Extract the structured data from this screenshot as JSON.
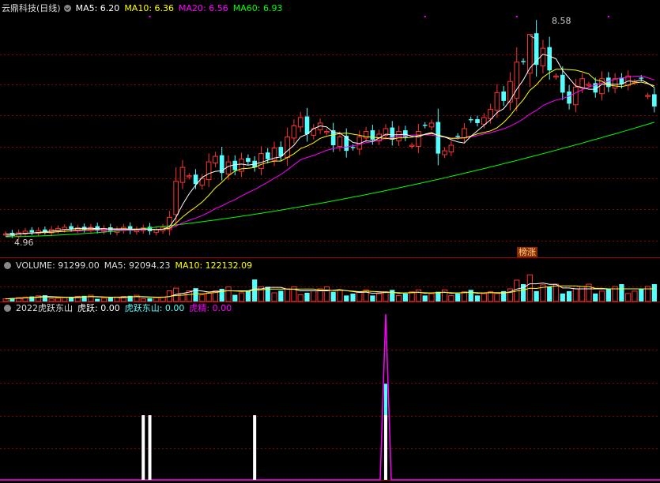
{
  "header_main": {
    "title": "云鼎科技(日线)",
    "ma5": "MA5: 6.20",
    "ma10": "MA10: 6.36",
    "ma20": "MA20: 6.56",
    "ma60": "MA60: 6.93"
  },
  "header_volume": {
    "title": "VOLUME: 91299.00",
    "ma5": "MA5: 92094.23",
    "ma10": "MA10: 122132.09"
  },
  "header_indicator": {
    "title": "2022虎跃东山",
    "huyue": "虎跃: 0.00",
    "huyuedongshan": "虎跃东山: 0.00",
    "hujing": "虎精: 0.00"
  },
  "annotations": {
    "high_price": "8.58",
    "low_price": "4.96",
    "badge": "榜涨"
  },
  "colors": {
    "up": "#ff3232",
    "down": "#54ffff",
    "ma5": "#ffffff",
    "ma10": "#ffff00",
    "ma20": "#ff00ff",
    "ma60": "#00ff00",
    "grid": "#8b0000",
    "ind_line": "#ff00ff",
    "signal": "#ffffff"
  },
  "chart_data": {
    "type": "candlestick",
    "n": 100,
    "price_range": [
      4.75,
      8.85
    ],
    "up_flags": [
      1,
      0,
      1,
      1,
      0,
      1,
      0,
      1,
      1,
      1,
      0,
      1,
      0,
      1,
      0,
      1,
      0,
      1,
      1,
      0,
      1,
      1,
      0,
      1,
      1,
      1,
      0,
      1,
      1,
      0,
      1,
      1,
      1,
      0,
      1,
      0,
      1,
      0,
      0,
      1,
      0,
      1,
      0,
      1,
      1,
      1,
      0,
      1,
      1,
      1,
      0,
      1,
      0,
      0,
      1,
      1,
      0,
      1,
      1,
      0,
      1,
      0,
      1,
      1,
      0,
      1,
      0,
      1,
      1,
      0,
      1,
      0,
      0,
      1,
      1,
      1,
      0,
      1,
      1,
      0,
      1,
      0,
      1,
      0,
      1,
      0,
      0,
      1,
      1,
      1,
      0,
      1,
      0,
      1,
      0,
      1,
      1,
      0,
      1,
      0
    ],
    "closes": [
      5.0,
      4.98,
      5.02,
      5.05,
      5.03,
      5.06,
      5.04,
      5.08,
      5.1,
      5.12,
      5.09,
      5.11,
      5.08,
      5.12,
      5.07,
      5.1,
      5.05,
      5.08,
      5.12,
      5.06,
      5.08,
      5.11,
      5.05,
      5.08,
      5.12,
      5.3,
      5.95,
      6.2,
      6.05,
      5.9,
      6.0,
      6.3,
      6.4,
      6.1,
      6.3,
      6.15,
      6.35,
      6.3,
      6.2,
      6.45,
      6.35,
      6.55,
      6.4,
      6.75,
      6.95,
      7.1,
      6.8,
      6.9,
      7.0,
      6.85,
      6.6,
      6.75,
      6.5,
      6.55,
      6.75,
      6.85,
      6.7,
      6.8,
      6.9,
      6.7,
      6.85,
      6.75,
      6.6,
      6.85,
      6.95,
      7.0,
      6.45,
      6.5,
      6.6,
      6.75,
      6.9,
      7.05,
      7.0,
      7.1,
      7.25,
      7.55,
      7.4,
      7.75,
      8.1,
      8.1,
      8.6,
      8.05,
      8.35,
      7.95,
      7.85,
      7.55,
      7.35,
      7.65,
      7.8,
      7.7,
      7.55,
      7.8,
      7.65,
      7.8,
      7.7,
      7.85,
      7.75,
      7.8,
      7.5,
      7.3
    ],
    "volume_range": [
      0,
      450000
    ],
    "indicator": {
      "signal_bars_at": [
        21,
        22,
        38,
        58
      ],
      "spike_at": 58,
      "spike_peak": 1.0
    }
  }
}
